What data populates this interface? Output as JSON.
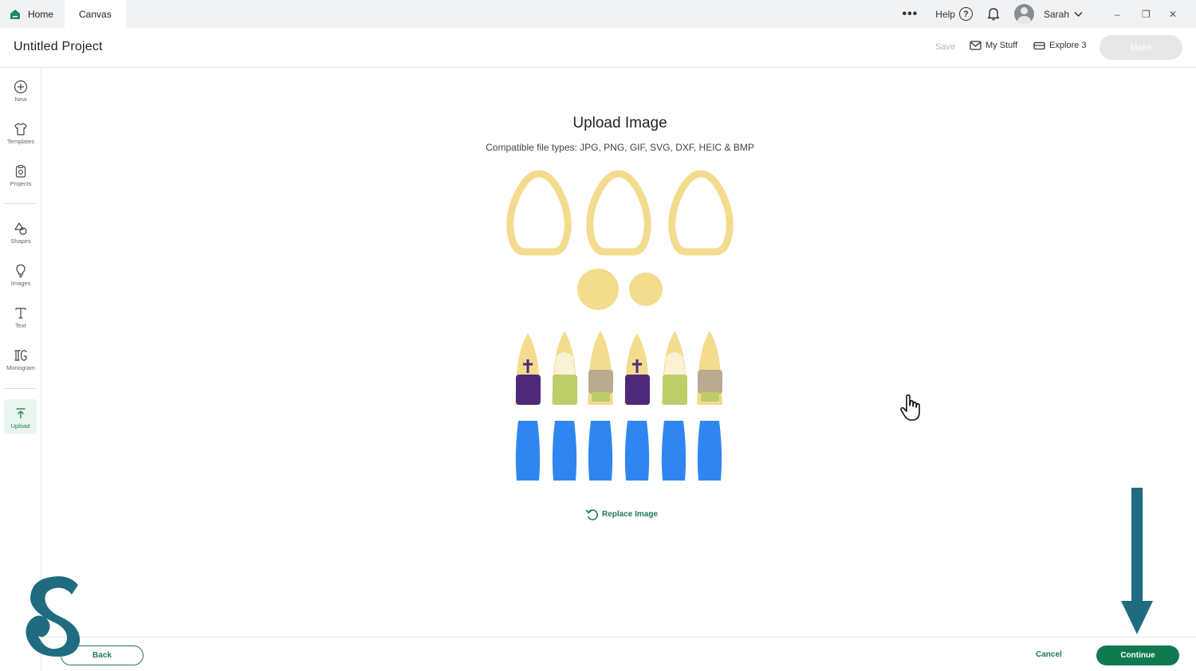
{
  "titlebar": {
    "tabs": [
      {
        "label": "Home",
        "icon": "home-icon",
        "active": false
      },
      {
        "label": "Canvas",
        "active": true
      }
    ],
    "more_icon": "more-dots-icon",
    "help_label": "Help",
    "help_glyph": "?",
    "user_name": "Sarah",
    "window_controls": {
      "minimize": "–",
      "restore": "❐",
      "close": "✕"
    }
  },
  "header": {
    "project_title": "Untitled Project",
    "save_label": "Save",
    "my_stuff_label": "My Stuff",
    "machine_label": "Explore 3",
    "make_label": "Make"
  },
  "sidebar": {
    "items": [
      {
        "label": "New",
        "icon": "plus-circle-icon"
      },
      {
        "label": "Templates",
        "icon": "tshirt-icon"
      },
      {
        "label": "Projects",
        "icon": "clipboard-icon"
      },
      {
        "label": "Shapes",
        "icon": "shapes-icon"
      },
      {
        "label": "Images",
        "icon": "lightbulb-icon"
      },
      {
        "label": "Text",
        "icon": "text-icon"
      },
      {
        "label": "Monogram",
        "icon": "monogram-icon"
      },
      {
        "label": "Upload",
        "icon": "upload-icon",
        "active": true
      }
    ]
  },
  "main": {
    "title": "Upload Image",
    "subtitle": "Compatible file types:  JPG, PNG, GIF, SVG, DXF, HEIC & BMP",
    "replace_label": "Replace Image"
  },
  "footer": {
    "back_label": "Back",
    "cancel_label": "Cancel",
    "continue_label": "Continue"
  },
  "colors": {
    "accent": "#0f7a4f",
    "watermark": "#1f6c80",
    "piece_yellow": "#f3dc8e",
    "piece_blue": "#2f86f0",
    "piece_purple": "#4f2a7a",
    "piece_green": "#bccd6a",
    "piece_taupe": "#b9ab90"
  }
}
